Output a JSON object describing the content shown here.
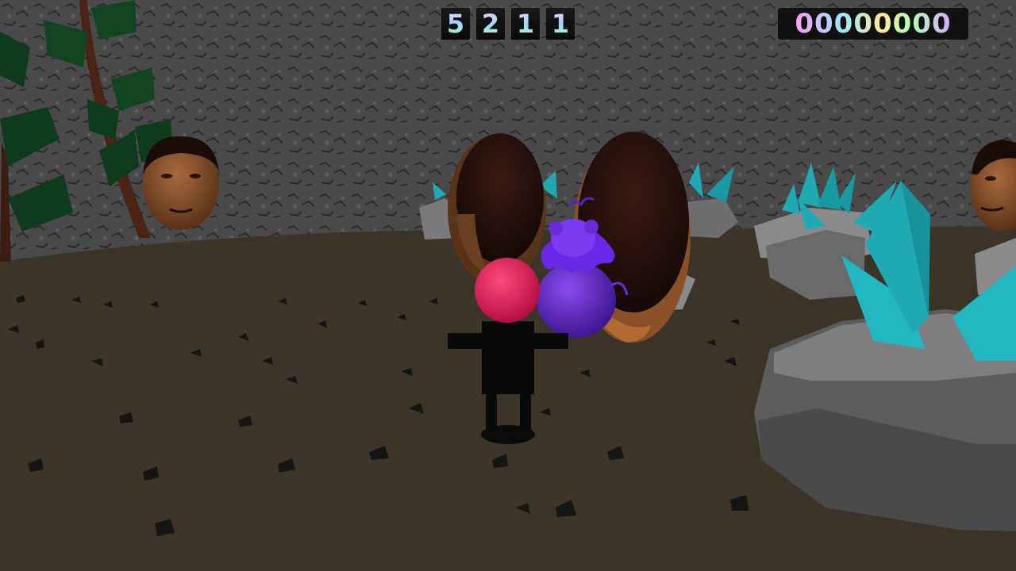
{
  "hud": {
    "lives_digits": [
      "5",
      "2",
      "1",
      "1"
    ],
    "score": "00000000"
  },
  "scene": {
    "sky_wall": "rocky-stone-wall",
    "ground": "dirt-ground",
    "colors": {
      "wall": "#4a4a4c",
      "ground": "#3b3528",
      "crystal": "#1fa9b2",
      "rock": "#6e6e70",
      "player_head": "#e0205a",
      "companion": "#6a2ad8",
      "leaf": "#0f3a1c"
    }
  }
}
